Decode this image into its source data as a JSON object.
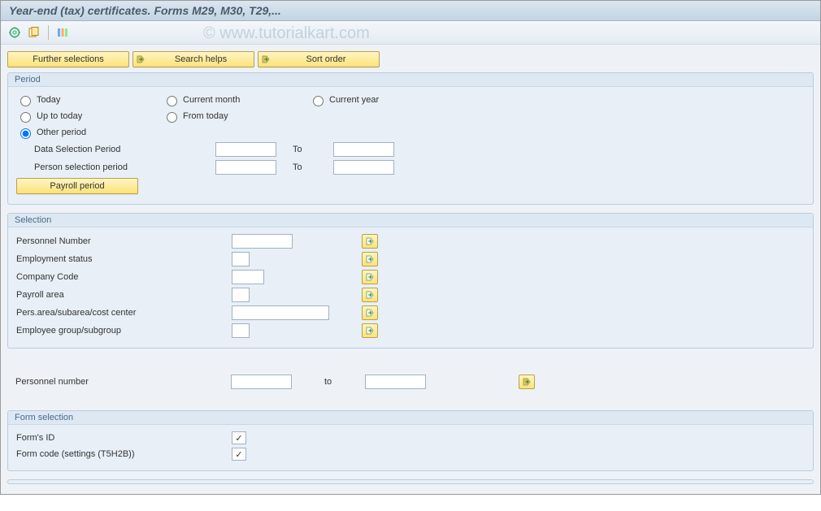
{
  "title": "Year-end (tax) certificates. Forms M29, M30, T29,...",
  "watermark": "© www.tutorialkart.com",
  "top_buttons": {
    "further": "Further selections",
    "search": "Search helps",
    "sort": "Sort order"
  },
  "period": {
    "title": "Period",
    "radios": {
      "today": "Today",
      "current_month": "Current month",
      "current_year": "Current year",
      "up_to_today": "Up to today",
      "from_today": "From today",
      "other_period": "Other period"
    },
    "selected": "other_period",
    "data_sel_label": "Data Selection Period",
    "person_sel_label": "Person selection period",
    "to_label": "To",
    "payroll_btn": "Payroll period",
    "data_from": "",
    "data_to": "",
    "person_from": "",
    "person_to": ""
  },
  "selection": {
    "title": "Selection",
    "rows": [
      {
        "label": "Personnel Number",
        "value": "",
        "width": "inp-med"
      },
      {
        "label": "Employment status",
        "value": "",
        "width": "inp-tiny"
      },
      {
        "label": "Company Code",
        "value": "",
        "width": "inp-med",
        "w2": "inp-small"
      },
      {
        "label": "Payroll area",
        "value": "",
        "width": "inp-tiny"
      },
      {
        "label": "Pers.area/subarea/cost center",
        "value": "",
        "width": "inp-long"
      },
      {
        "label": "Employee group/subgroup",
        "value": "",
        "width": "inp-tiny"
      }
    ]
  },
  "range": {
    "label": "Personnel number",
    "from": "",
    "to": "",
    "to_label": "to"
  },
  "form_selection": {
    "title": "Form selection",
    "rows": [
      {
        "label": "Form's ID",
        "checked": true
      },
      {
        "label": "Form code (settings (T5H2B))",
        "checked": true
      }
    ]
  }
}
